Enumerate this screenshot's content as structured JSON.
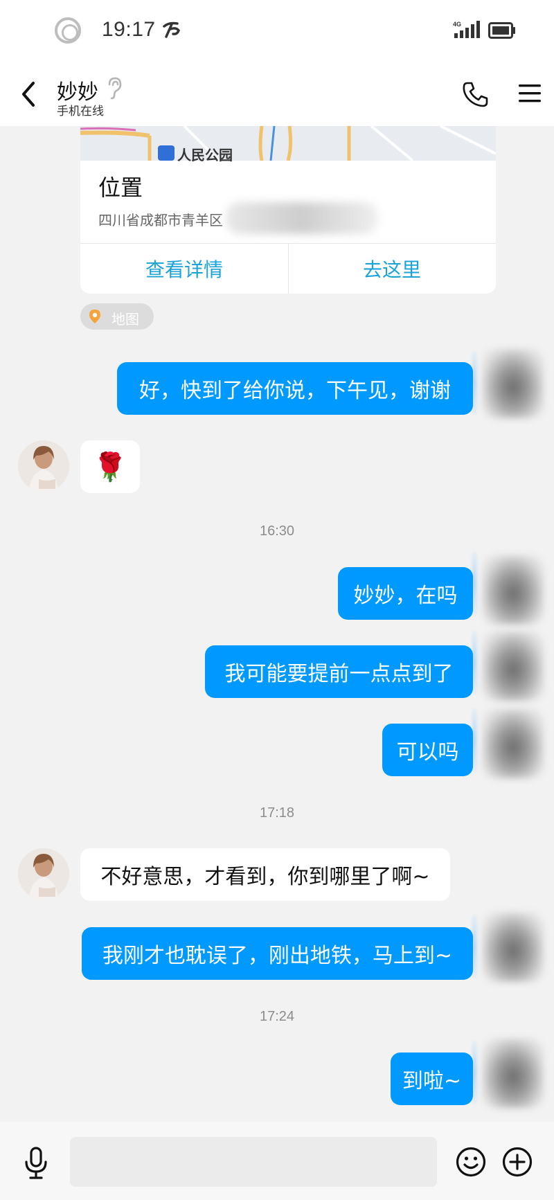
{
  "status_bar": {
    "time": "19:17",
    "network": "4G",
    "icons": [
      "record-circle-icon",
      "carrier-icon",
      "signal-icon",
      "battery-icon"
    ]
  },
  "header": {
    "contact_name": "妙妙",
    "contact_status": "手机在线",
    "icons": [
      "back-icon",
      "ear-icon",
      "phone-icon",
      "menu-icon"
    ]
  },
  "location_card": {
    "map_label": "人民公园",
    "title": "位置",
    "address": "四川省成都市青羊区",
    "view_details": "查看详情",
    "go_here": "去这里",
    "map_tag": "地图"
  },
  "messages": [
    {
      "from": "me",
      "text": "好，快到了给你说，下午见，谢谢"
    },
    {
      "from": "friend",
      "text": "🌹"
    },
    {
      "time": "16:30"
    },
    {
      "from": "me",
      "text": "妙妙，在吗"
    },
    {
      "from": "me",
      "text": "我可能要提前一点点到了"
    },
    {
      "from": "me",
      "text": "可以吗"
    },
    {
      "time": "17:18"
    },
    {
      "from": "friend",
      "text": "不好意思，才看到，你到哪里了啊~"
    },
    {
      "from": "me",
      "text": "我刚才也耽误了，刚出地铁，马上到~"
    },
    {
      "time": "17:24"
    },
    {
      "from": "me",
      "text": "到啦~"
    }
  ],
  "input_bar": {
    "placeholder": "",
    "icons": [
      "mic-icon",
      "emoji-icon",
      "plus-icon"
    ]
  },
  "colors": {
    "accent": "#0099ff",
    "link": "#1aa3d9",
    "background": "#f2f2f2"
  }
}
